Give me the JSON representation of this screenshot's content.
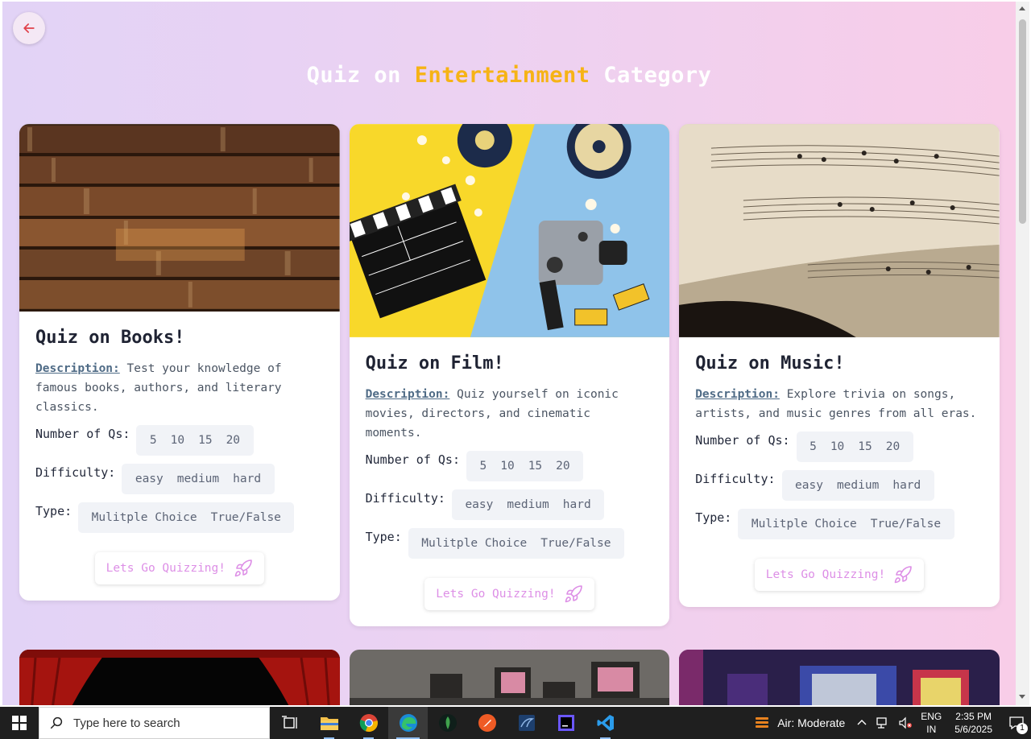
{
  "page": {
    "title_prefix": "Quiz on",
    "title_highlight": "Entertainment",
    "title_suffix": "Category"
  },
  "labels": {
    "description": "Description:",
    "num_qs": "Number of Qs:",
    "difficulty": "Difficulty:",
    "type": "Type:",
    "go_button": "Lets Go Quizzing!"
  },
  "options": {
    "num_qs": [
      "5",
      "10",
      "15",
      "20"
    ],
    "difficulty": [
      "easy",
      "medium",
      "hard"
    ],
    "type": [
      "Mulitple Choice",
      "True/False"
    ]
  },
  "cards": [
    {
      "title": "Quiz on Books!",
      "description": "Test your knowledge of famous books, authors, and literary classics."
    },
    {
      "title": "Quiz on Film!",
      "description": "Quiz yourself on iconic movies, directors, and cinematic moments."
    },
    {
      "title": "Quiz on Music!",
      "description": "Explore trivia on songs, artists, and music genres from all eras."
    }
  ],
  "taskbar": {
    "search_placeholder": "Type here to search",
    "weather": "Air: Moderate",
    "lang_line1": "ENG",
    "lang_line2": "IN",
    "time": "2:35 PM",
    "date": "5/6/2025",
    "notification_count": "1"
  },
  "colors": {
    "accent_title": "#f6b315",
    "button_text": "#dd8fe6",
    "description_label": "#4f6b86"
  }
}
